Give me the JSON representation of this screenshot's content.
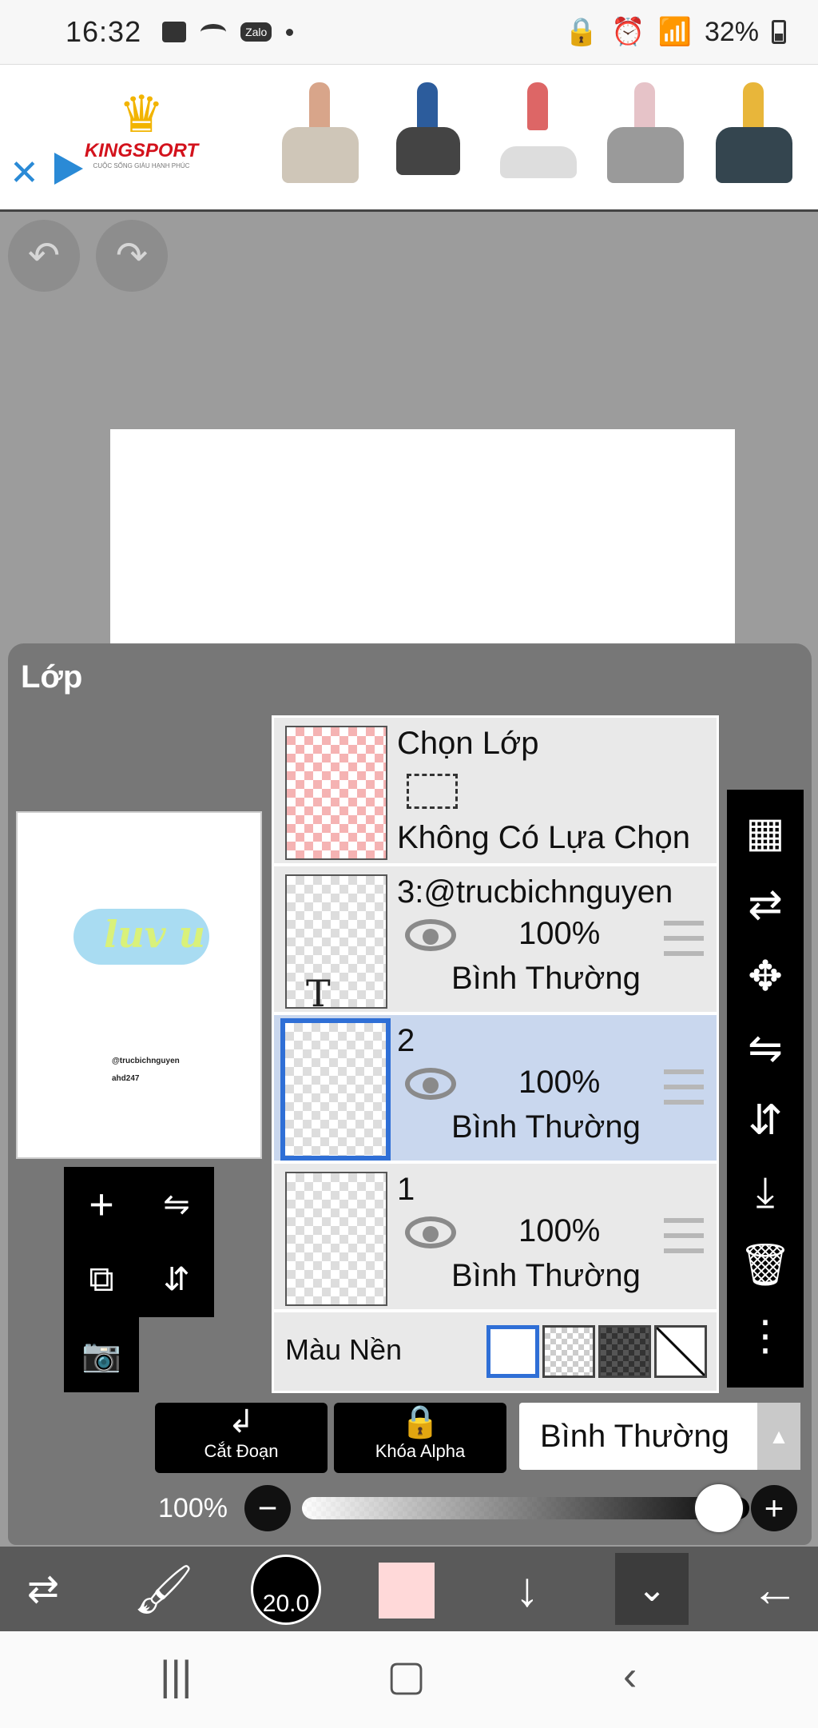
{
  "status_bar": {
    "time": "16:32",
    "battery": "32%",
    "zalo": "Zalo"
  },
  "ad": {
    "brand": "KINGSPORT",
    "tagline": "CUỘC SỐNG GIÀU HẠNH PHÚC",
    "close_icon": "close-icon",
    "adchoices_icon": "adchoices-icon"
  },
  "canvas_tools": {
    "undo_icon": "undo-icon",
    "redo_icon": "redo-icon"
  },
  "panel": {
    "title": "Lớp",
    "preview": {
      "art_text": "luv u",
      "credit_line1": "@trucbichnguyen",
      "credit_line2": "ahd247"
    }
  },
  "layers": {
    "selection": {
      "title": "Chọn Lớp",
      "status": "Không Có Lựa Chọn"
    },
    "items": [
      {
        "name": "3:@trucbichnguyen",
        "opacity": "100%",
        "blend": "Bình Thường",
        "text_glyph": "T"
      },
      {
        "name": "2",
        "opacity": "100%",
        "blend": "Bình Thường"
      },
      {
        "name": "1",
        "opacity": "100%",
        "blend": "Bình Thường"
      }
    ],
    "background": {
      "label": "Màu Nền"
    }
  },
  "controls": {
    "clipping_label": "Cắt Đoạn",
    "alpha_lock_label": "Khóa Alpha",
    "blend_mode": "Bình Thường",
    "opacity_label": "100%",
    "opacity_value": 1.0
  },
  "bottom_toolbar": {
    "brush_size": "20.0",
    "color": "#ffd9d9"
  },
  "colors": {
    "accent": "#2f6fd6",
    "selected_row": "#c9d7ee",
    "panel": "#767676"
  }
}
